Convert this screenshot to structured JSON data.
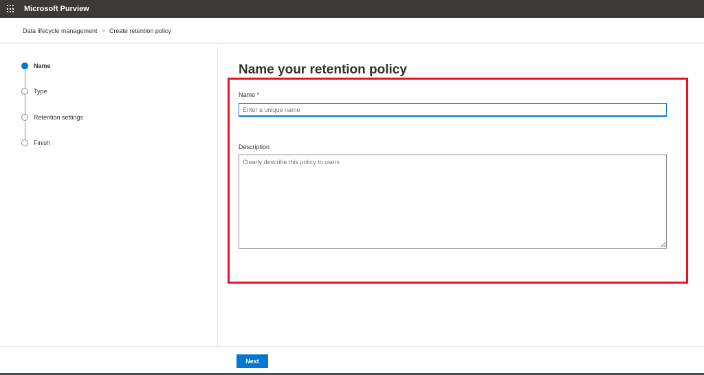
{
  "app": {
    "title": "Microsoft Purview"
  },
  "breadcrumb": [
    "Data lifecycle management",
    "Create retention policy"
  ],
  "steps": [
    {
      "label": "Name",
      "active": true
    },
    {
      "label": "Type",
      "active": false
    },
    {
      "label": "Retention settings",
      "active": false
    },
    {
      "label": "Finish",
      "active": false
    }
  ],
  "main": {
    "heading": "Name your retention policy",
    "name_label": "Name *",
    "name_placeholder": "Enter a unique name",
    "description_label": "Description",
    "description_placeholder": "Clearly describe this policy to users"
  },
  "footer": {
    "next_label": "Next"
  },
  "colors": {
    "accent": "#0078d4",
    "highlight": "#e81123",
    "topbar": "#3b3a39"
  }
}
